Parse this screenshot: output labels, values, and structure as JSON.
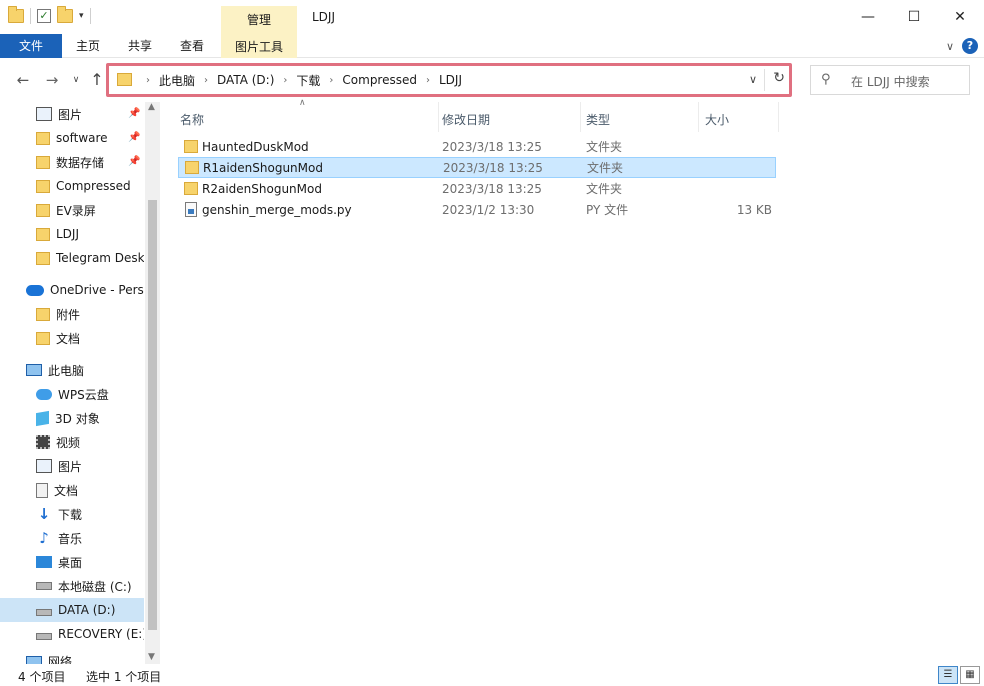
{
  "window": {
    "title": "LDJJ",
    "contextual_tab": "管理",
    "min_glyph": "—",
    "max_glyph": "☐",
    "close_glyph": "✕"
  },
  "ribbon": {
    "tabs": [
      "文件",
      "主页",
      "共享",
      "查看",
      "图片工具"
    ],
    "help": "?"
  },
  "nav": {
    "back": "←",
    "forward": "→",
    "recent": "∨",
    "up": "↑",
    "breadcrumbs": [
      "此电脑",
      "DATA (D:)",
      "下载",
      "Compressed",
      "LDJJ"
    ],
    "crumb_separator": "›",
    "refresh": "↻",
    "search_placeholder": "在 LDJJ 中搜索"
  },
  "sidebar": {
    "items": [
      {
        "label": "图片",
        "icon": "pictures-icon",
        "pinned": true
      },
      {
        "label": "software",
        "icon": "folder-icon",
        "pinned": true
      },
      {
        "label": "数据存储",
        "icon": "folder-icon",
        "pinned": true
      },
      {
        "label": "Compressed",
        "icon": "folder-icon",
        "pinned": false
      },
      {
        "label": "EV录屏",
        "icon": "folder-icon",
        "pinned": false
      },
      {
        "label": "LDJJ",
        "icon": "folder-icon",
        "pinned": false
      },
      {
        "label": "Telegram Desk",
        "icon": "folder-icon",
        "pinned": false
      },
      {
        "label": "OneDrive - Perso",
        "icon": "onedrive-icon",
        "pinned": false
      },
      {
        "label": "附件",
        "icon": "folder-icon",
        "pinned": false
      },
      {
        "label": "文档",
        "icon": "folder-icon",
        "pinned": false
      },
      {
        "label": "此电脑",
        "icon": "this-pc-icon",
        "pinned": false
      },
      {
        "label": "WPS云盘",
        "icon": "wps-cloud-icon",
        "pinned": false
      },
      {
        "label": "3D 对象",
        "icon": "3d-objects-icon",
        "pinned": false
      },
      {
        "label": "视频",
        "icon": "videos-icon",
        "pinned": false
      },
      {
        "label": "图片",
        "icon": "pictures-icon",
        "pinned": false
      },
      {
        "label": "文档",
        "icon": "documents-icon",
        "pinned": false
      },
      {
        "label": "下载",
        "icon": "downloads-icon",
        "pinned": false
      },
      {
        "label": "音乐",
        "icon": "music-icon",
        "pinned": false
      },
      {
        "label": "桌面",
        "icon": "desktop-icon",
        "pinned": false
      },
      {
        "label": "本地磁盘 (C:)",
        "icon": "local-disk-icon",
        "pinned": false
      },
      {
        "label": "DATA (D:)",
        "icon": "drive-icon",
        "pinned": false,
        "selected": true
      },
      {
        "label": "RECOVERY (E:)",
        "icon": "drive-icon",
        "pinned": false
      },
      {
        "label": "网络",
        "icon": "network-icon",
        "pinned": false
      }
    ]
  },
  "columns": {
    "name": "名称",
    "date": "修改日期",
    "type": "类型",
    "size": "大小"
  },
  "files": [
    {
      "name": "HauntedDuskMod",
      "date": "2023/3/18 13:25",
      "type": "文件夹",
      "size": "",
      "icon": "folder-icon",
      "selected": false
    },
    {
      "name": "R1aidenShogunMod",
      "date": "2023/3/18 13:25",
      "type": "文件夹",
      "size": "",
      "icon": "folder-icon",
      "selected": true
    },
    {
      "name": "R2aidenShogunMod",
      "date": "2023/3/18 13:25",
      "type": "文件夹",
      "size": "",
      "icon": "folder-icon",
      "selected": false
    },
    {
      "name": "genshin_merge_mods.py",
      "date": "2023/1/2 13:30",
      "type": "PY 文件",
      "size": "13 KB",
      "icon": "python-file-icon",
      "selected": false
    }
  ],
  "status": {
    "count": "4 个项目",
    "selection": "选中 1 个项目"
  },
  "colors": {
    "file_tab": "#1b62b8",
    "contextual_tab": "#fcf2c5",
    "address_highlight": "#e07080",
    "selection": "#cce8ff"
  }
}
